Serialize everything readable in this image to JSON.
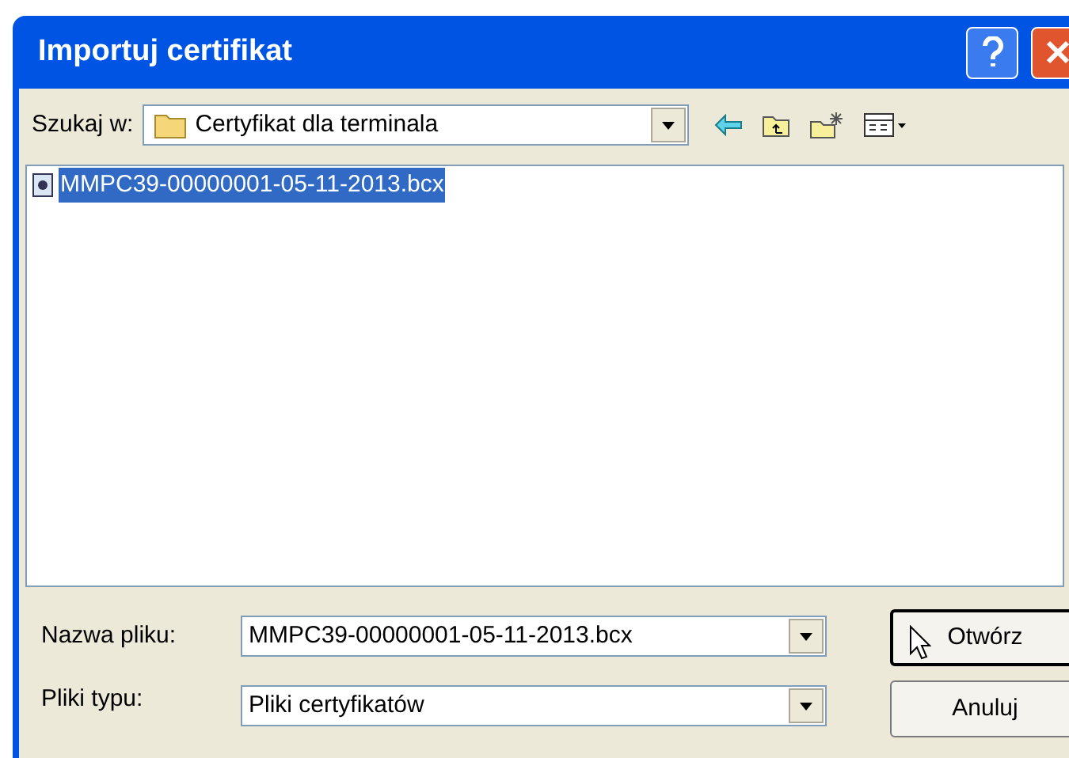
{
  "window": {
    "title": "Importuj certifikat"
  },
  "look_in": {
    "label": "Szukaj w:",
    "value": "Certyfikat dla terminala"
  },
  "files": [
    {
      "name": "MMPC39-00000001-05-11-2013.bcx",
      "selected": true
    }
  ],
  "file_name": {
    "label": "Nazwa pliku:",
    "value": "MMPC39-00000001-05-11-2013.bcx"
  },
  "file_type": {
    "label": "Pliki typu:",
    "value": "Pliki certyfikatów"
  },
  "buttons": [
    {
      "label": "Otwórz",
      "kind": "default"
    },
    {
      "label": "Anuluj",
      "kind": "normal"
    }
  ]
}
